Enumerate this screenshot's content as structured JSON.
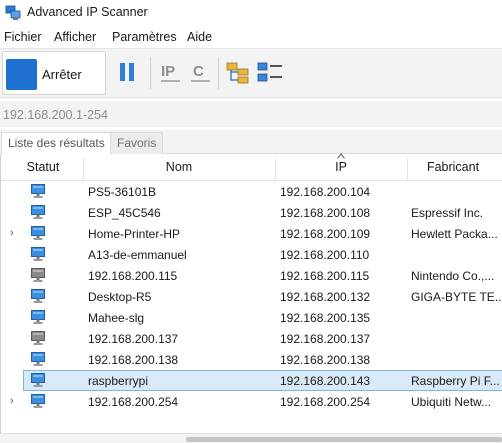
{
  "window": {
    "title": "Advanced IP Scanner"
  },
  "menu": [
    "Fichier",
    "Afficher",
    "Paramètres",
    "Aide"
  ],
  "toolbar": {
    "stop_label": "Arrêter",
    "ip_label": "IP",
    "c_label": "C"
  },
  "range": {
    "value": "192.168.200.1-254"
  },
  "tabs": [
    {
      "label": "Liste des résultats",
      "active": true
    },
    {
      "label": "Favoris",
      "active": false
    }
  ],
  "columns": {
    "status": "Statut",
    "name": "Nom",
    "ip": "IP",
    "vendor": "Fabricant"
  },
  "rows": [
    {
      "expandable": false,
      "status": "online",
      "name": "PS5-36101B",
      "ip": "192.168.200.104",
      "vendor": ""
    },
    {
      "expandable": false,
      "status": "online",
      "name": "ESP_45C546",
      "ip": "192.168.200.108",
      "vendor": "Espressif Inc."
    },
    {
      "expandable": true,
      "status": "online",
      "name": "Home-Printer-HP",
      "ip": "192.168.200.109",
      "vendor": "Hewlett Packa..."
    },
    {
      "expandable": false,
      "status": "online",
      "name": "A13-de-emmanuel",
      "ip": "192.168.200.110",
      "vendor": ""
    },
    {
      "expandable": false,
      "status": "offline",
      "name": "192.168.200.115",
      "ip": "192.168.200.115",
      "vendor": "Nintendo Co.,..."
    },
    {
      "expandable": false,
      "status": "online",
      "name": "Desktop-R5",
      "ip": "192.168.200.132",
      "vendor": "GIGA-BYTE TE..."
    },
    {
      "expandable": false,
      "status": "online",
      "name": "Mahee-slg",
      "ip": "192.168.200.135",
      "vendor": ""
    },
    {
      "expandable": false,
      "status": "offline",
      "name": "192.168.200.137",
      "ip": "192.168.200.137",
      "vendor": ""
    },
    {
      "expandable": false,
      "status": "online",
      "name": "192.168.200.138",
      "ip": "192.168.200.138",
      "vendor": ""
    },
    {
      "expandable": false,
      "status": "online",
      "name": "raspberrypi",
      "ip": "192.168.200.143",
      "vendor": "Raspberry Pi F...",
      "selected": true
    },
    {
      "expandable": true,
      "status": "online",
      "name": "192.168.200.254",
      "ip": "192.168.200.254",
      "vendor": "Ubiquiti Netw..."
    }
  ],
  "colors": {
    "accent": "#1f6fd1",
    "selection": "#d8eaf7",
    "selection_border": "#7fb6e0"
  }
}
